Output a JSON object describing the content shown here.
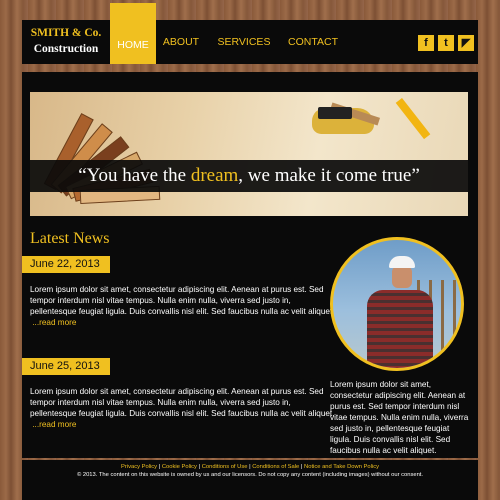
{
  "logo": {
    "line1": "SMITH & Co.",
    "line2": "Construction"
  },
  "nav": [
    {
      "label": "HOME",
      "active": true
    },
    {
      "label": "ABOUT",
      "active": false
    },
    {
      "label": "SERVICES",
      "active": false
    },
    {
      "label": "CONTACT",
      "active": false
    }
  ],
  "social": [
    {
      "icon": "facebook-icon",
      "glyph": "f"
    },
    {
      "icon": "twitter-icon",
      "glyph": "t"
    },
    {
      "icon": "rss-icon",
      "glyph": "◤"
    }
  ],
  "hero": {
    "quote_before": "“You have the ",
    "quote_highlight": "dream",
    "quote_after": ", we make it come true”"
  },
  "news": {
    "heading": "Latest News",
    "items": [
      {
        "date": "June 22, 2013",
        "text": "Lorem ipsum dolor sit amet, consectetur adipiscing elit. Aenean at purus est. Sed tempor interdum nisl vitae tempus. Nulla enim nulla, viverra sed justo in, pellentesque feugiat ligula. Duis convallis nisl elit. Sed faucibus nulla ac velit aliquet.",
        "read_more": "...read more"
      },
      {
        "date": "June 25, 2013",
        "text": "Lorem ipsum dolor sit amet, consectetur adipiscing elit. Aenean at purus est. Sed tempor interdum nisl vitae tempus. Nulla enim nulla, viverra sed justo in, pellentesque feugiat ligula. Duis convallis nisl elit. Sed faucibus nulla ac velit aliquet.",
        "read_more": "...read more"
      }
    ]
  },
  "sidebar": {
    "text": "Lorem ipsum dolor sit amet, consectetur adipiscing elit. Aenean at purus est. Sed tempor interdum nisl vitae tempus. Nulla enim nulla, viverra sed justo in, pellentesque feugiat ligula. Duis convallis nisl elit. Sed faucibus nulla ac velit aliquet."
  },
  "footer": {
    "links": [
      "Privacy Policy",
      "Cookie Policy",
      "Conditions of Use",
      "Conditions of Sale",
      "Notice and Take Down Policy"
    ],
    "copyright": "© 2013. The content on this website is owned by us and our licensors. Do not copy any content (including images) without our consent."
  },
  "colors": {
    "accent": "#f0c020",
    "panel": "#0a0a0a",
    "text": "#ffffff"
  }
}
